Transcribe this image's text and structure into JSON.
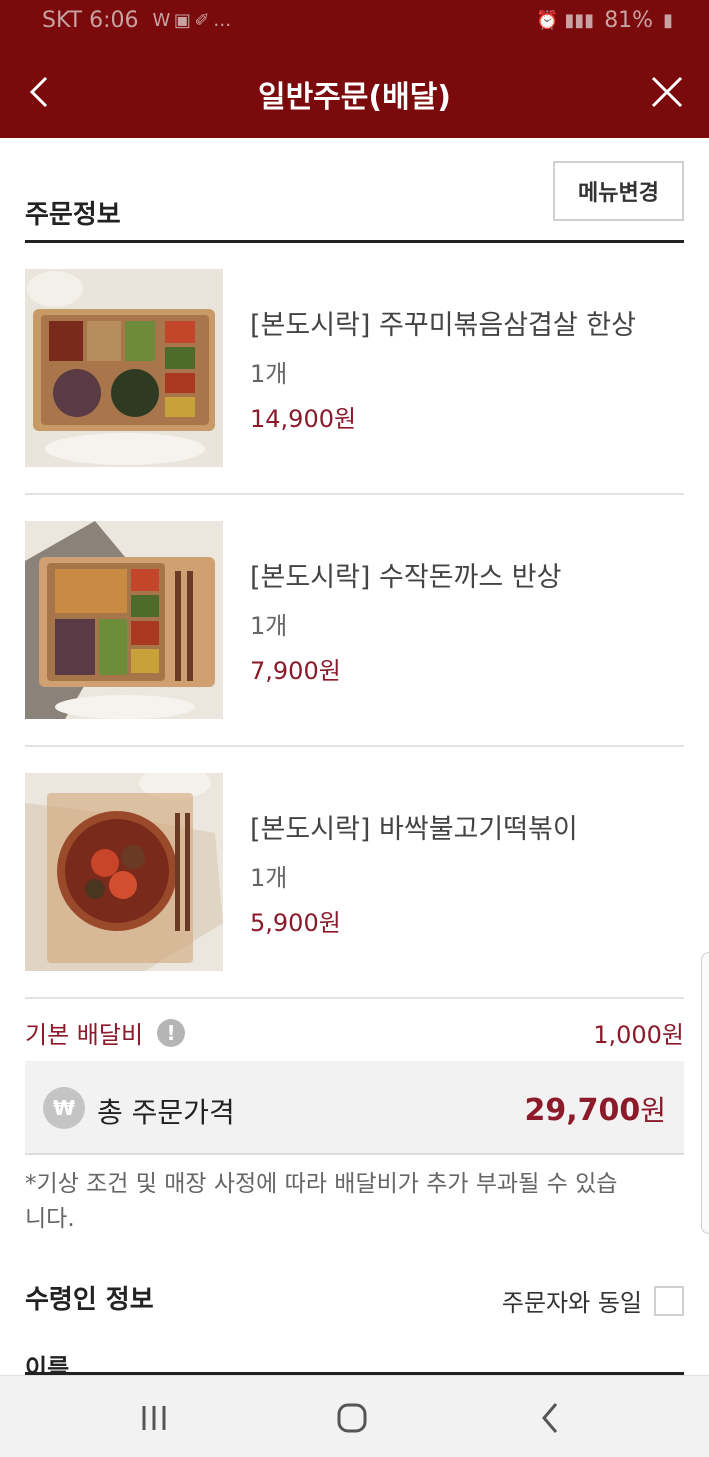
{
  "status_bar": {
    "carrier_time": "SKT 6:06",
    "notif_icons": "W ▣ ✐ …",
    "battery": "81%"
  },
  "header": {
    "title": "일반주문(배달)",
    "bg_color": "#7a0a0b"
  },
  "order_info": {
    "title": "주문정보",
    "menu_change_label": "메뉴변경",
    "items": [
      {
        "name": "[본도시락] 주꾸미볶음삼겹살 한상",
        "qty": "1개",
        "price": "14,900원",
        "image_icon": "lunchbox-photo"
      },
      {
        "name": "[본도시락] 수작돈까스 반상",
        "qty": "1개",
        "price": "7,900원",
        "image_icon": "lunchbox-photo"
      },
      {
        "name": "[본도시락] 바싹불고기떡볶이",
        "qty": "1개",
        "price": "5,900원",
        "image_icon": "tteokbokki-photo"
      }
    ]
  },
  "delivery": {
    "fee_label": "기본 배달비",
    "info_icon": "!",
    "fee_value": "1,000원"
  },
  "total": {
    "won_icon": "₩",
    "label": "총 주문가격",
    "value": "29,700",
    "unit": "원"
  },
  "notice": "*기상 조건 및 매장 사정에 따라 배달비가 추가 부과될 수 있습니다.",
  "recipient": {
    "title": "수령인 정보",
    "same_as_orderer_label": "주문자와 동일",
    "same_as_orderer_checked": false,
    "name_label": "이름"
  },
  "accent_color": "#8b1a2a"
}
